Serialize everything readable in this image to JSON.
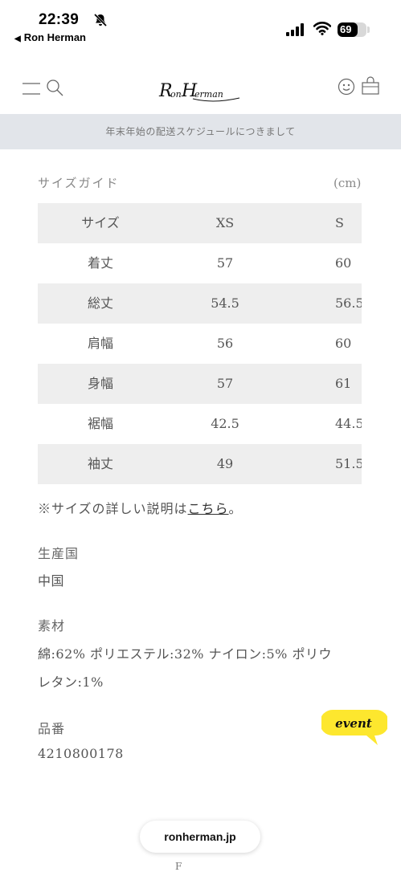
{
  "status_bar": {
    "time": "22:39",
    "back_label": "Ron Herman",
    "battery": "69",
    "battery_fraction": 0.69
  },
  "header": {
    "logo_text": "RonHerman"
  },
  "notice": "年末年始の配送スケジュールにつきまして",
  "size_guide": {
    "title": "サイズガイド",
    "unit": "(cm)",
    "headers": [
      "サイズ",
      "XS",
      "S"
    ],
    "rows": [
      [
        "着丈",
        "57",
        "60"
      ],
      [
        "総丈",
        "54.5",
        "56.5"
      ],
      [
        "肩幅",
        "56",
        "60"
      ],
      [
        "身幅",
        "57",
        "61"
      ],
      [
        "裾幅",
        "42.5",
        "44.5"
      ],
      [
        "袖丈",
        "49",
        "51.5"
      ]
    ],
    "note_prefix": "※サイズの詳しい説明は",
    "note_link": "こちら",
    "note_suffix": "。"
  },
  "details": {
    "origin_label": "生産国",
    "origin_value": "中国",
    "material_label": "素材",
    "material_line1": "綿:62% ポリエステル:32% ナイロン:5% ポリウ",
    "material_line2": "レタン:1%",
    "sku_label": "品番",
    "sku_value": "4210800178"
  },
  "event_badge": "event",
  "domain": "ronherman.jp",
  "peek_text": "F",
  "colors": {
    "notice_bg": "#e2e5ea",
    "row_shade": "#eeeeee",
    "event_yellow": "#fde72e"
  }
}
